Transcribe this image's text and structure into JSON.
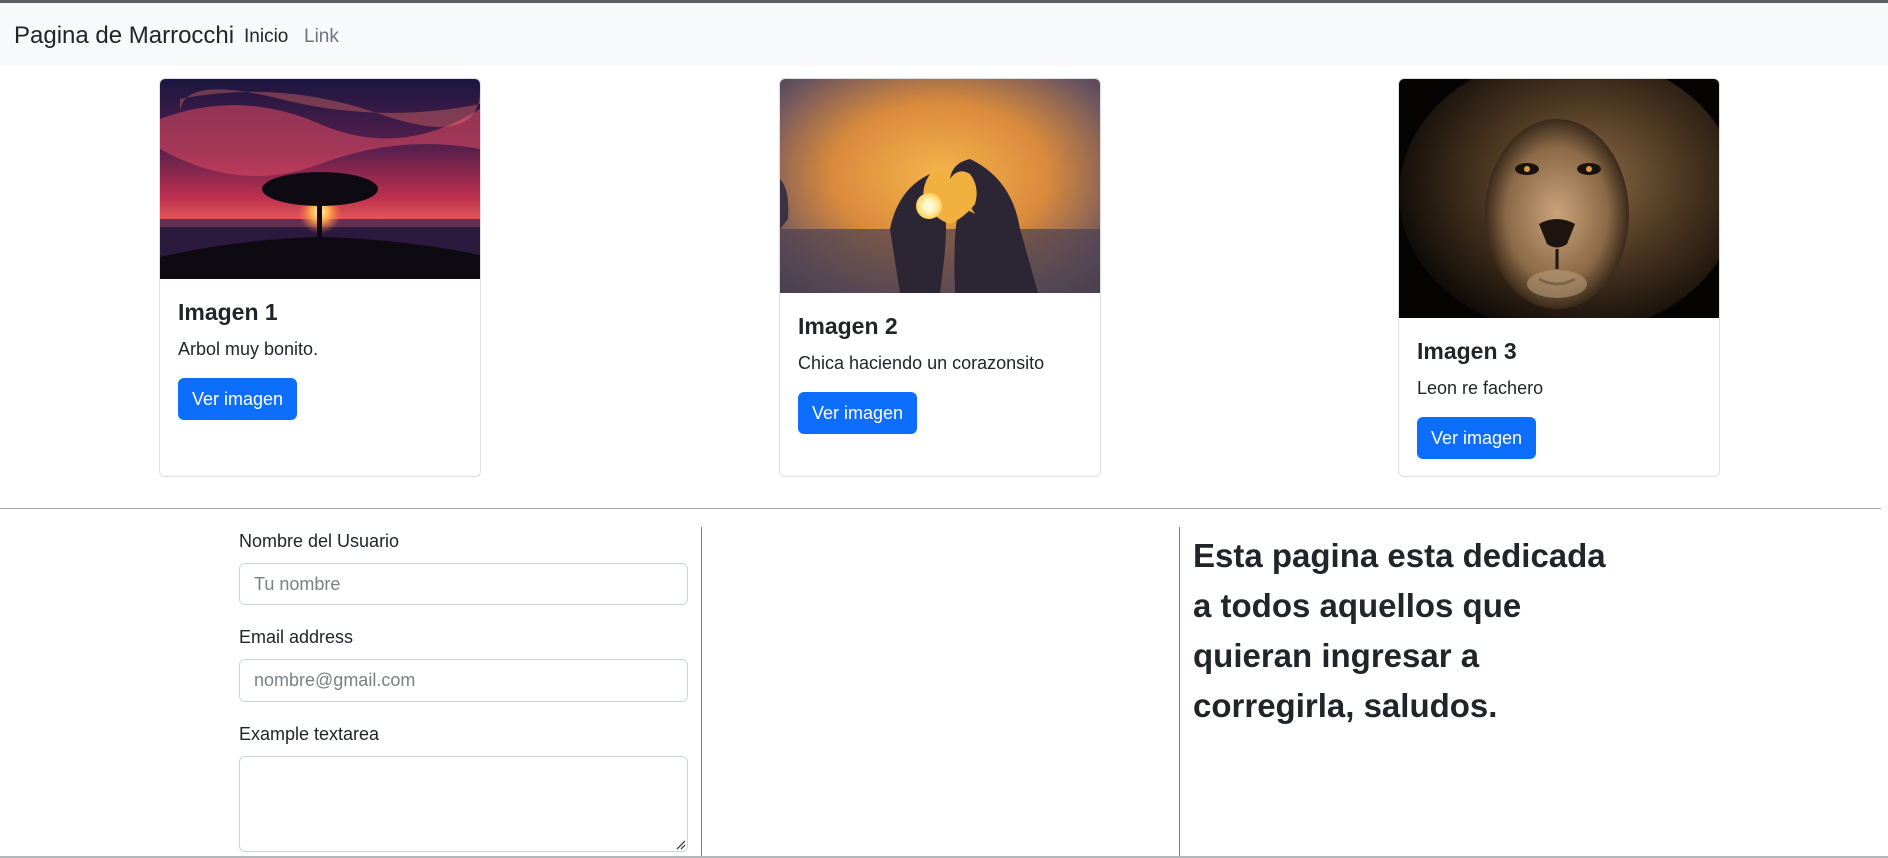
{
  "navbar": {
    "brand": "Pagina de Marrocchi",
    "links": [
      {
        "label": "Inicio",
        "active": true
      },
      {
        "label": "Link",
        "active": false
      }
    ]
  },
  "cards": [
    {
      "title": "Imagen 1",
      "text": "Arbol muy bonito.",
      "button": "Ver imagen",
      "image": "sunset-tree-image"
    },
    {
      "title": "Imagen 2",
      "text": "Chica haciendo un corazonsito",
      "button": "Ver imagen",
      "image": "heart-hands-sun-image"
    },
    {
      "title": "Imagen 3",
      "text": "Leon re fachero",
      "button": "Ver imagen",
      "image": "lion-face-image"
    }
  ],
  "form": {
    "name_label": "Nombre del Usuario",
    "name_placeholder": "Tu nombre",
    "email_label": "Email address",
    "email_placeholder": "nombre@gmail.com",
    "textarea_label": "Example textarea",
    "textarea_value": ""
  },
  "dedication": "Esta pagina esta dedicada a todos aquellos que quieran ingresar a corregirla, saludos.",
  "colors": {
    "primary": "#0d6efd",
    "navbar_bg": "#f8f9fa",
    "text": "#212529",
    "muted": "#6c757d"
  }
}
